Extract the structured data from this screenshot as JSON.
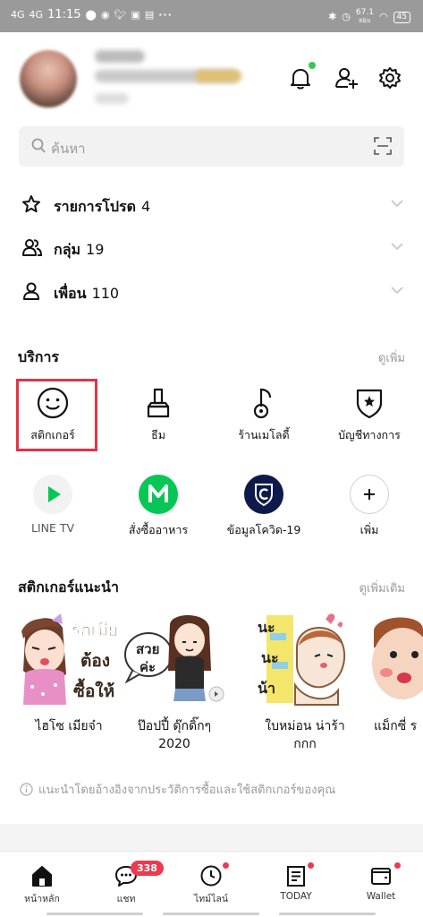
{
  "status_bar": {
    "signal1": "4G",
    "signal2": "4G",
    "time": "11:15",
    "speed": "67.1",
    "speed_unit": "KB/s",
    "battery": "45"
  },
  "search": {
    "placeholder": "ค้นหา"
  },
  "lists": [
    {
      "label": "รายการโปรด",
      "count": "4",
      "icon": "star-icon"
    },
    {
      "label": "กลุ่ม",
      "count": "19",
      "icon": "group-icon"
    },
    {
      "label": "เพื่อน",
      "count": "110",
      "icon": "person-icon"
    }
  ],
  "services": {
    "title": "บริการ",
    "more": "ดูเพิ่ม",
    "items": [
      {
        "label": "สติกเกอร์",
        "icon": "smiley-icon"
      },
      {
        "label": "ธีม",
        "icon": "brush-icon"
      },
      {
        "label": "ร้านเมโลดี้",
        "icon": "music-note-icon"
      },
      {
        "label": "บัญชีทางการ",
        "icon": "shield-star-icon"
      },
      {
        "label": "LINE TV",
        "icon": "play-icon"
      },
      {
        "label": "สั่งซื้ออาหาร",
        "icon": "line-man-icon"
      },
      {
        "label": "ข้อมูลโควิด-19",
        "icon": "covid-shield-icon"
      },
      {
        "label": "เพิ่ม",
        "icon": "plus-icon"
      }
    ]
  },
  "stickers": {
    "title": "สติกเกอร์แนะนำ",
    "more": "ดูเพิ่มเติม",
    "items": [
      {
        "name": "ไฮโซ เมียจ๋า",
        "art_text1": "รักเมีย",
        "art_text2": "ต้อง",
        "art_text3": "ซื้อให้"
      },
      {
        "name": "ป๊อปปี้ ดุ๊กดิ๊กๆ",
        "name2": "2020",
        "art_text1": "สวย",
        "art_text2": "ค่ะ"
      },
      {
        "name": "ใบหม่อน น่าร้า",
        "name2": "กกก",
        "art_text1": "นะ",
        "art_text2": "นะ",
        "art_text3": "น้า"
      },
      {
        "name": "แม็กซี่ ร"
      }
    ],
    "note": "แนะนำโดยอ้างอิงจากประวัติการซื้อและใช้สติกเกอร์ของคุณ"
  },
  "tabbar": [
    {
      "label": "หน้าหลัก",
      "icon": "home-icon"
    },
    {
      "label": "แชท",
      "icon": "chat-icon",
      "badge": "338"
    },
    {
      "label": "ไทม์ไลน์",
      "icon": "timeline-clock-icon"
    },
    {
      "label": "TODAY",
      "icon": "today-news-icon"
    },
    {
      "label": "Wallet",
      "icon": "wallet-icon"
    }
  ],
  "colors": {
    "accent_red": "#e53244",
    "badge": "#ea3b50",
    "line_green": "#06c755",
    "online_dot": "#3cc45a"
  }
}
